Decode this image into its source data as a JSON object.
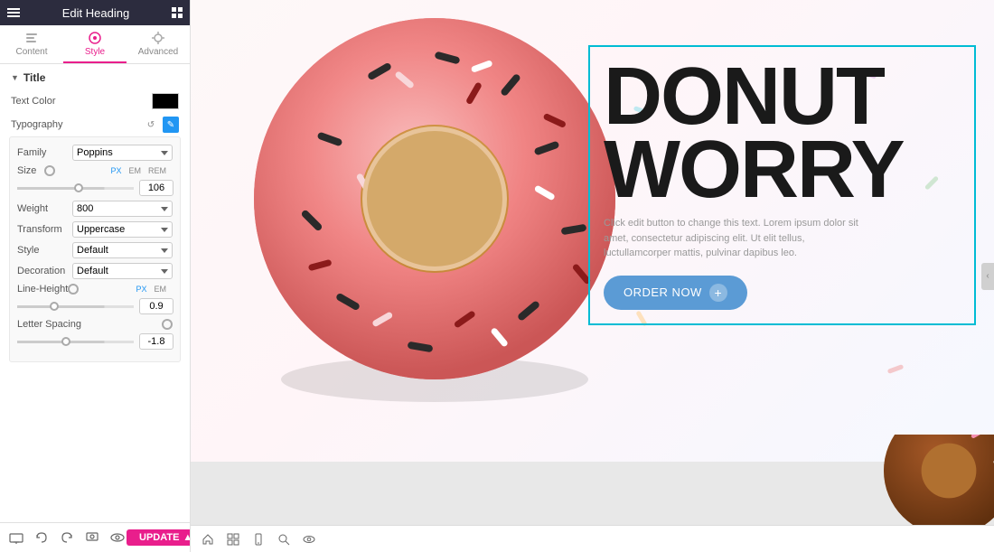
{
  "panel": {
    "header_title": "Edit Heading",
    "tabs": [
      {
        "id": "content",
        "label": "Content"
      },
      {
        "id": "style",
        "label": "Style",
        "active": true
      },
      {
        "id": "advanced",
        "label": "Advanced"
      }
    ]
  },
  "title_section": {
    "label": "Title"
  },
  "text_color": {
    "label": "Text Color",
    "value": "#000000"
  },
  "typography": {
    "label": "Typography"
  },
  "font": {
    "family_label": "Family",
    "family_value": "Poppins",
    "size_label": "Size",
    "size_value": "106",
    "units": [
      "PX",
      "EM",
      "REM"
    ],
    "weight_label": "Weight",
    "weight_value": "800",
    "transform_label": "Transform",
    "transform_value": "Uppercase",
    "style_label": "Style",
    "style_value": "Default",
    "decoration_label": "Decoration",
    "decoration_value": "Default",
    "line_height_label": "Line-Height",
    "line_height_value": "0.9",
    "line_height_units": [
      "PX",
      "EM"
    ],
    "letter_spacing_label": "Letter Spacing",
    "letter_spacing_value": "-1.8"
  },
  "canvas": {
    "heading_line1": "DONUT",
    "heading_line2": "WORRY",
    "body_text": "Click edit button to change this text. Lorem ipsum dolor sit amet, consectetur adipiscing elit. Ut elit tellus, luctullamcorper mattis, pulvinar dapibus leo.",
    "button_label": "ORDER NOW",
    "button_plus": "+"
  },
  "bottom_bar": {
    "update_label": "UPDATE"
  }
}
